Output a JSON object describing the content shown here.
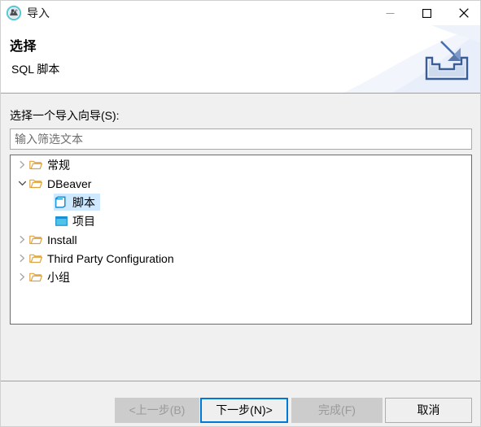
{
  "window": {
    "title": "导入",
    "icon": "dbeaver-app-icon",
    "controls": {
      "minimize": "minimize-icon",
      "maximize": "maximize-icon",
      "close": "close-icon"
    }
  },
  "header": {
    "title": "选择",
    "subtitle": "SQL 脚本",
    "banner_icon": "import-tray-icon"
  },
  "body": {
    "wizard_label": "选择一个导入向导(S):",
    "filter": {
      "value": "",
      "placeholder": "输入筛选文本"
    },
    "tree": [
      {
        "label": "常规",
        "icon": "folder-icon",
        "state": "collapsed",
        "depth": 0,
        "selected": false
      },
      {
        "label": "DBeaver",
        "icon": "folder-icon",
        "state": "expanded",
        "depth": 0,
        "selected": false
      },
      {
        "label": "脚本",
        "icon": "script-icon",
        "state": "leaf",
        "depth": 1,
        "selected": true
      },
      {
        "label": "项目",
        "icon": "project-icon",
        "state": "leaf",
        "depth": 1,
        "selected": false
      },
      {
        "label": "Install",
        "icon": "folder-icon",
        "state": "collapsed",
        "depth": 0,
        "selected": false
      },
      {
        "label": "Third Party Configuration",
        "icon": "folder-icon",
        "state": "collapsed",
        "depth": 0,
        "selected": false
      },
      {
        "label": "小组",
        "icon": "folder-icon",
        "state": "collapsed",
        "depth": 0,
        "selected": false
      }
    ]
  },
  "footer": {
    "back": "<上一步(B)",
    "next": "下一步(N)>",
    "finish": "完成(F)",
    "cancel": "取消"
  },
  "colors": {
    "accent": "#0078d7",
    "selection": "#cde8ff",
    "folder": "#e8a33d",
    "dialog_bg": "#f0f0f0"
  }
}
